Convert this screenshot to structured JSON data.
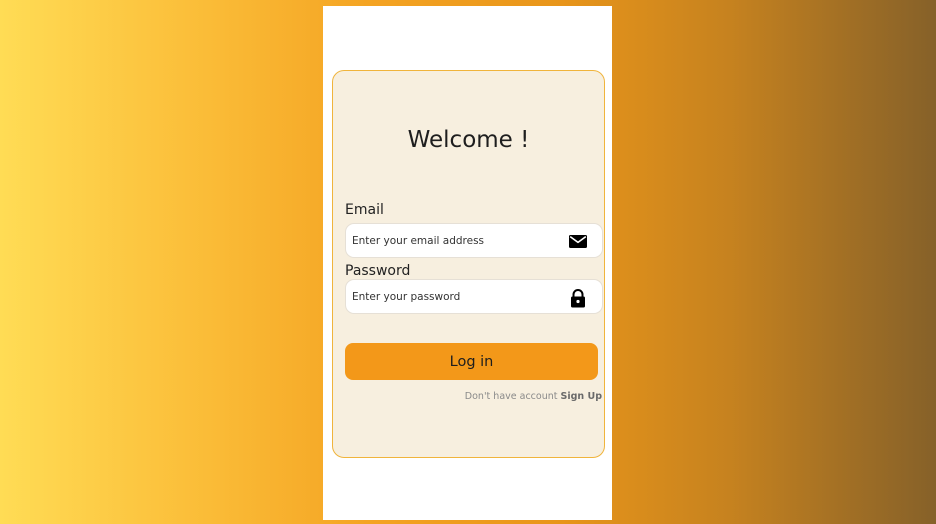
{
  "login": {
    "title": "Welcome !",
    "email_label": "Email",
    "email_placeholder": "Enter your email address",
    "email_icon": "envelope-icon",
    "password_label": "Password",
    "password_placeholder": "Enter your password",
    "password_icon": "lock-icon",
    "login_button": "Log in",
    "signup_prompt": "Don't have account",
    "signup_link": "Sign Up"
  },
  "colors": {
    "accent": "#f39819",
    "card_background": "#f7efdf",
    "card_border": "#f0b43c"
  }
}
